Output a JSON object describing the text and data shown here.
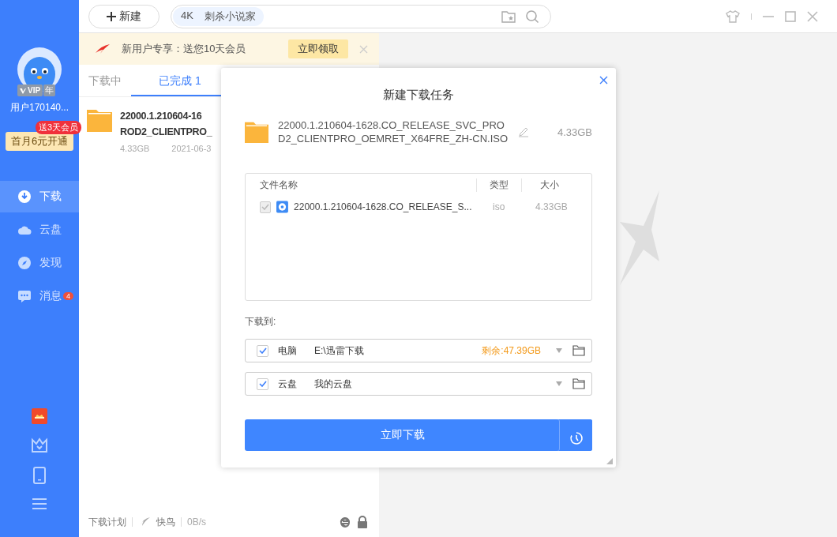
{
  "sidebar": {
    "vip_badge": "VIP",
    "year_badge": "年",
    "username": "用户170140...",
    "promo_badge": "送3天会员",
    "promo_button": "首月6元开通",
    "items": [
      {
        "label": "下载",
        "selected": true
      },
      {
        "label": "云盘",
        "selected": false
      },
      {
        "label": "发现",
        "selected": false
      },
      {
        "label": "消息",
        "selected": false,
        "badge": "4"
      }
    ]
  },
  "toolbar": {
    "new_button": "新建",
    "search_tags": [
      "4K",
      "刺杀小说家"
    ]
  },
  "banner": {
    "text": "新用户专享：送您10天会员",
    "button": "立即领取"
  },
  "tabs": [
    {
      "label": "下载中",
      "selected": false
    },
    {
      "label": "已完成",
      "count": "1",
      "selected": true
    }
  ],
  "downloads": [
    {
      "name_lines": [
        "22000.1.210604-16",
        "ROD2_CLIENTPRO_"
      ],
      "size": "4.33GB",
      "date": "2021-06-3"
    }
  ],
  "status_bar": {
    "plan": "下载计划",
    "accelerator": "快鸟",
    "speed": "0B/s"
  },
  "dialog": {
    "title": "新建下载任务",
    "file_name": "22000.1.210604-1628.CO_RELEASE_SVC_PROD2_CLIENTPRO_OEMRET_X64FRE_ZH-CN.ISO",
    "file_size": "4.33GB",
    "columns": [
      "文件名称",
      "类型",
      "大小"
    ],
    "files": [
      {
        "name": "22000.1.210604-1628.CO_RELEASE_S...",
        "type": "iso",
        "size": "4.33GB",
        "checked": true,
        "disabled": true
      }
    ],
    "save_label": "下载到:",
    "destinations": [
      {
        "kind": "local",
        "label": "电脑",
        "path": "E:\\迅雷下载",
        "free": "剩余:47.39GB",
        "checked": true
      },
      {
        "kind": "cloud",
        "label": "云盘",
        "path": "我的云盘",
        "checked": true
      }
    ],
    "download_button": "立即下载"
  }
}
